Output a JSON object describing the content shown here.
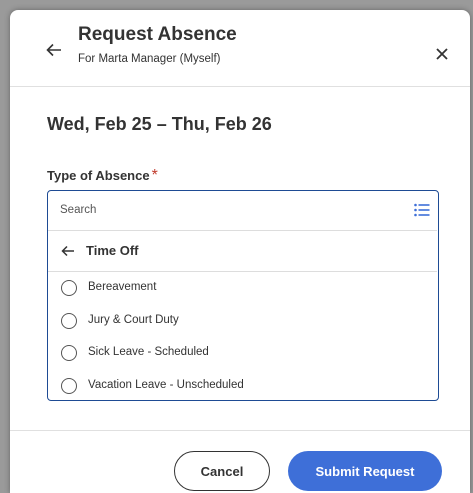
{
  "header": {
    "title": "Request Absence",
    "subtitle": "For Marta Manager (Myself)",
    "back_icon": "arrow-left-icon",
    "close_icon": "close-icon"
  },
  "date_range": "Wed, Feb 25 – Thu, Feb 26",
  "absence_type": {
    "label": "Type of Absence",
    "required_marker": "*",
    "search_placeholder": "Search",
    "list_icon": "list-icon",
    "group_label": "Time Off",
    "options": [
      "Bereavement",
      "Jury & Court Duty",
      "Sick Leave - Scheduled",
      "Vacation Leave - Unscheduled"
    ]
  },
  "footer": {
    "cancel_label": "Cancel",
    "submit_label": "Submit Request"
  },
  "colors": {
    "primary": "#3e6fd8",
    "focus_border": "#1e4b94",
    "required": "#c0392b"
  }
}
